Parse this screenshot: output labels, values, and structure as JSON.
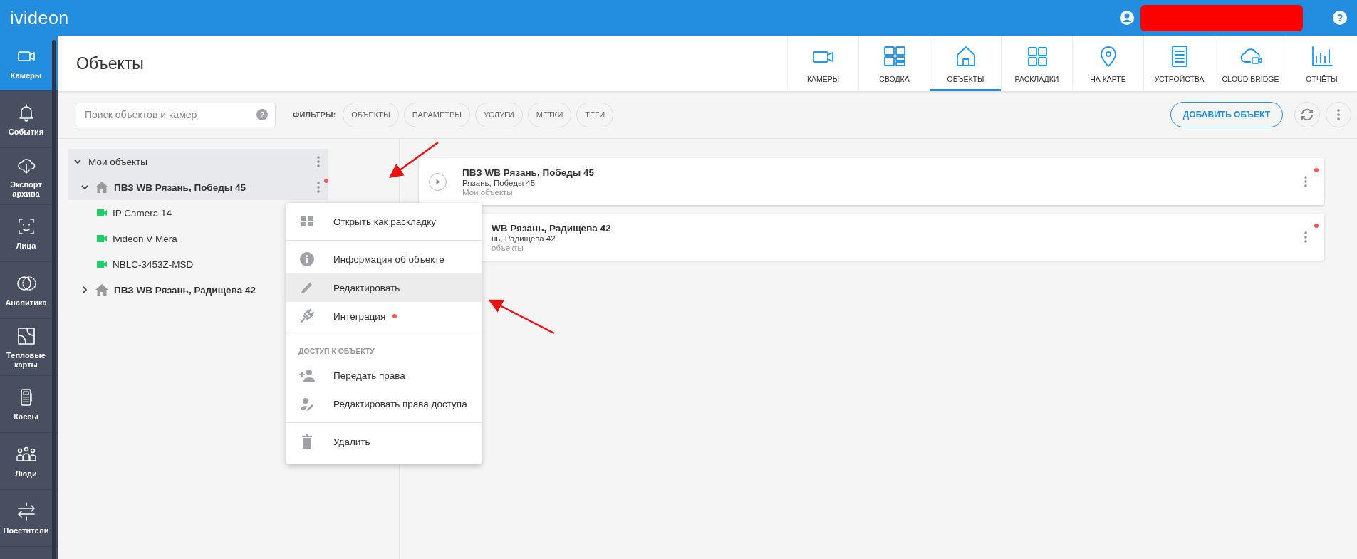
{
  "app": {
    "logo": "ivideon",
    "help": "?"
  },
  "sidebar": {
    "items": [
      {
        "label": "Камеры",
        "kind": "camera",
        "selected": true
      },
      {
        "label": "События",
        "kind": "bell",
        "selected": false
      },
      {
        "label": "Экспорт архива",
        "kind": "cloud",
        "selected": false
      },
      {
        "label": "Лица",
        "kind": "face",
        "selected": false
      },
      {
        "label": "Аналитика",
        "kind": "analytics",
        "selected": false
      },
      {
        "label": "Тепловые карты",
        "kind": "heatmap",
        "selected": false
      },
      {
        "label": "Кассы",
        "kind": "register",
        "selected": false
      },
      {
        "label": "Люди",
        "kind": "people",
        "selected": false
      },
      {
        "label": "Посетители",
        "kind": "visitors",
        "selected": false
      }
    ]
  },
  "page_title": "Объекты",
  "nav_tabs": [
    {
      "label": "КАМЕРЫ",
      "kind": "camera",
      "selected": false
    },
    {
      "label": "СВОДКА",
      "kind": "summary",
      "selected": false
    },
    {
      "label": "ОБЪЕКТЫ",
      "kind": "home",
      "selected": true
    },
    {
      "label": "РАСКЛАДКИ",
      "kind": "grid",
      "selected": false
    },
    {
      "label": "НА КАРТЕ",
      "kind": "pin",
      "selected": false
    },
    {
      "label": "УСТРОЙСТВА",
      "kind": "device",
      "selected": false
    },
    {
      "label": "CLOUD BRIDGE",
      "kind": "cloudcam",
      "selected": false
    },
    {
      "label": "ОТЧЁТЫ",
      "kind": "chart",
      "selected": false
    }
  ],
  "search": {
    "placeholder": "Поиск объектов и камер",
    "help": "?"
  },
  "filters": {
    "label": "ФИЛЬТРЫ:",
    "chips": [
      "ОБЪЕКТЫ",
      "ПАРАМЕТРЫ",
      "УСЛУГИ",
      "МЕТКИ",
      "ТЕГИ"
    ]
  },
  "add_button": "ДОБАВИТЬ ОБЪЕКТ",
  "tree": {
    "label": "Мои объекты",
    "expanded": true,
    "children": [
      {
        "label": "ПВЗ WB Рязань, Победы 45",
        "expanded": true,
        "selected": true,
        "alert": true,
        "children": [
          {
            "label": "IP Camera 14"
          },
          {
            "label": "Ivideon V Mera"
          },
          {
            "label": "NBLC-3453Z-MSD"
          }
        ]
      },
      {
        "label": "ПВЗ WB Рязань, Радищева 42",
        "expanded": false,
        "selected": false,
        "alert": false
      }
    ]
  },
  "context_menu": {
    "sections": [
      {
        "items": [
          {
            "label": "Открыть как раскладку",
            "kind": "grid",
            "selected": false,
            "alert": false
          }
        ]
      },
      {
        "items": [
          {
            "label": "Информация об объекте",
            "kind": "info",
            "selected": false,
            "alert": false
          },
          {
            "label": "Редактировать",
            "kind": "edit",
            "selected": true,
            "alert": false
          },
          {
            "label": "Интеграция",
            "kind": "plug",
            "selected": false,
            "alert": true
          }
        ]
      },
      {
        "heading": "ДОСТУП К ОБЪЕКТУ",
        "items": [
          {
            "label": "Передать права",
            "kind": "adduser",
            "selected": false,
            "alert": false
          },
          {
            "label": "Редактировать права доступа",
            "kind": "useredit",
            "selected": false,
            "alert": false
          }
        ]
      },
      {
        "items": [
          {
            "label": "Удалить",
            "kind": "trash",
            "selected": false,
            "alert": false
          }
        ]
      }
    ]
  },
  "cards": [
    {
      "title": "ПВЗ WB Рязань, Победы 45",
      "address": "Рязань, Победы 45",
      "group": "Мои объекты",
      "alert": true,
      "covered": false
    },
    {
      "title": "WB Рязань, Радищева 42",
      "address": "нь, Радищева 42",
      "group": "объекты",
      "alert": true,
      "covered": true
    }
  ]
}
